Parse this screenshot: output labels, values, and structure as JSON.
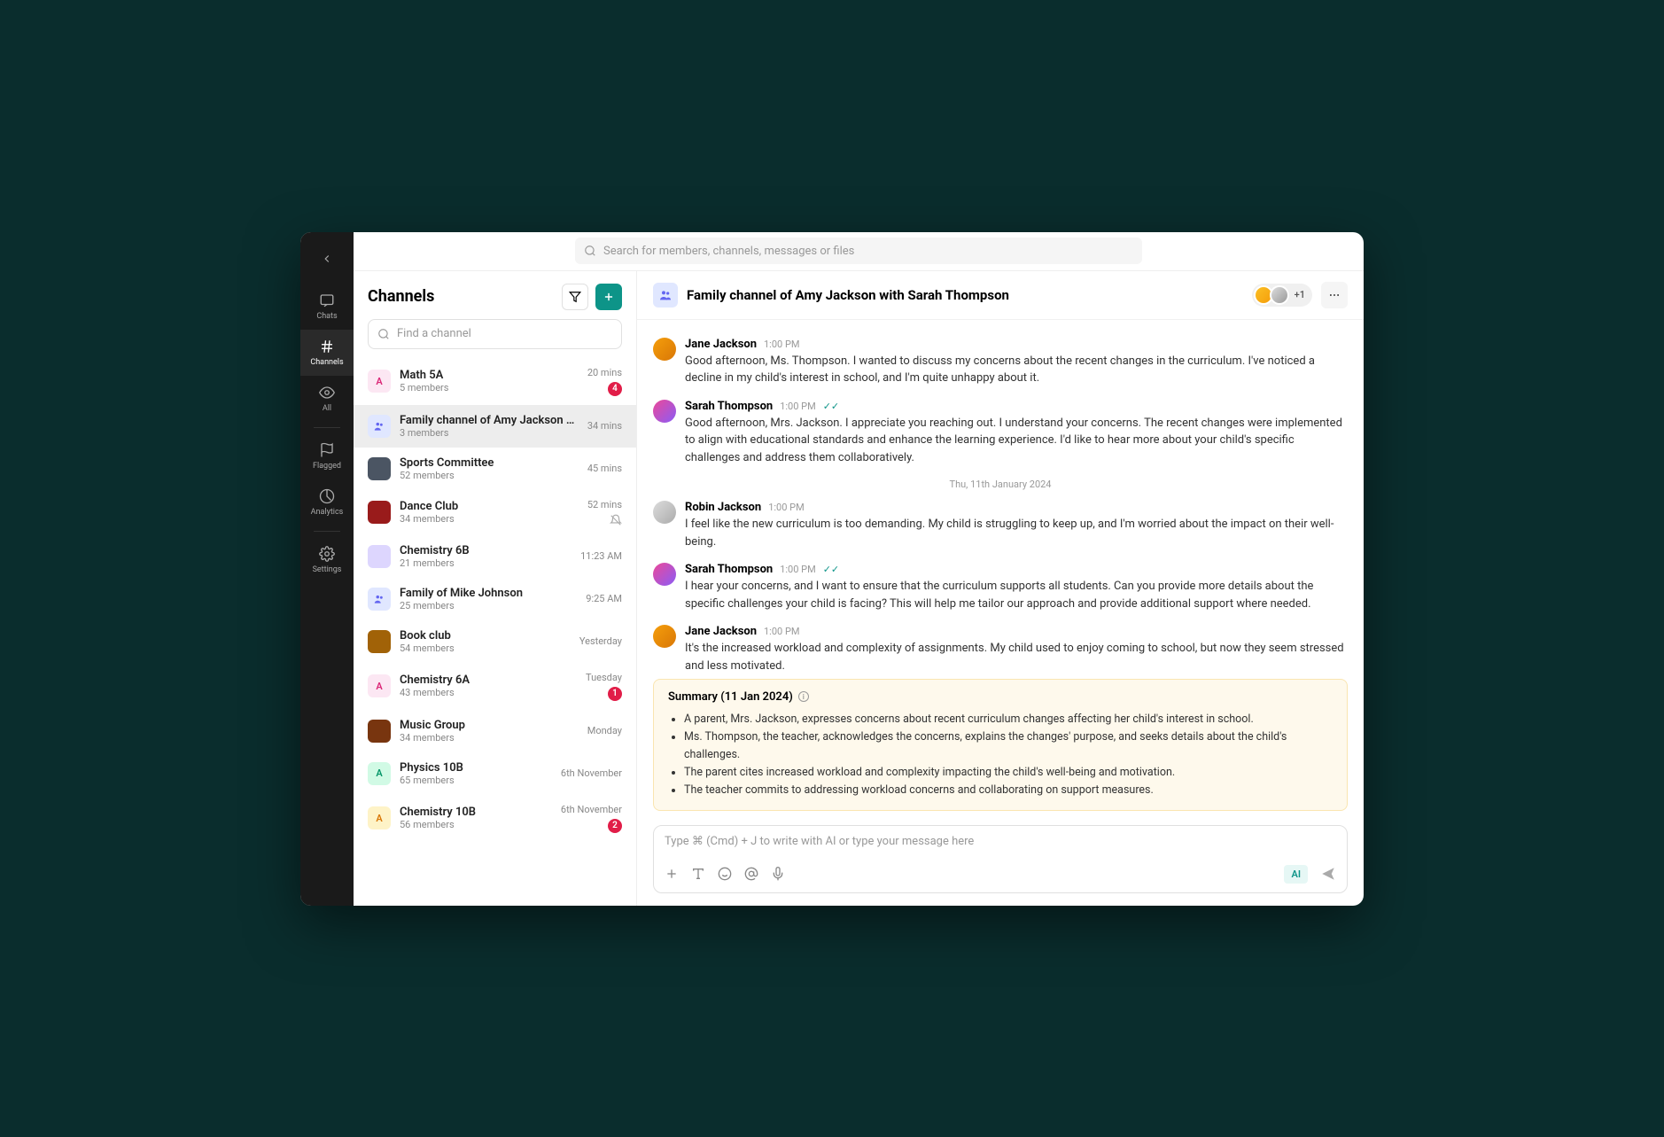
{
  "search": {
    "placeholder": "Search for members, channels, messages or files"
  },
  "nav": {
    "chats": "Chats",
    "channels": "Channels",
    "all": "All",
    "flagged": "Flagged",
    "analytics": "Analytics",
    "settings": "Settings"
  },
  "sidebar": {
    "title": "Channels",
    "search_placeholder": "Find a channel",
    "items": [
      {
        "letter": "A",
        "color": "#fce7f3",
        "fg": "#db2777",
        "name": "Math 5A",
        "sub": "5 members",
        "time": "20 mins",
        "badge": "4"
      },
      {
        "letter": "",
        "color": "#e0e7ff",
        "fg": "#6366f1",
        "name": "Family channel of Amy Jackson with S...",
        "sub": "3 members",
        "time": "34 mins",
        "badge": "",
        "icon": "people"
      },
      {
        "letter": "",
        "color": "#4b5563",
        "fg": "#fff",
        "name": "Sports Committee",
        "sub": "52 members",
        "time": "45 mins",
        "badge": "",
        "img": true
      },
      {
        "letter": "",
        "color": "#991b1b",
        "fg": "#fff",
        "name": "Dance Club",
        "sub": "34 members",
        "time": "52 mins",
        "badge": "",
        "mute": true,
        "img": true
      },
      {
        "letter": "",
        "color": "#ddd6fe",
        "fg": "#7c3aed",
        "name": "Chemistry 6B",
        "sub": "21 members",
        "time": "11:23 AM",
        "badge": "",
        "img": true
      },
      {
        "letter": "",
        "color": "#e0e7ff",
        "fg": "#6366f1",
        "name": "Family of Mike Johnson",
        "sub": "25 members",
        "time": "9:25 AM",
        "badge": "",
        "icon": "people"
      },
      {
        "letter": "",
        "color": "#a16207",
        "fg": "#fff",
        "name": "Book club",
        "sub": "54 members",
        "time": "Yesterday",
        "badge": "",
        "img": true
      },
      {
        "letter": "A",
        "color": "#fce7f3",
        "fg": "#db2777",
        "name": "Chemistry 6A",
        "sub": "43 members",
        "time": "Tuesday",
        "badge": "1"
      },
      {
        "letter": "",
        "color": "#78350f",
        "fg": "#fff",
        "name": "Music Group",
        "sub": "34 members",
        "time": "Monday",
        "badge": "",
        "img": true
      },
      {
        "letter": "A",
        "color": "#d1fae5",
        "fg": "#059669",
        "name": "Physics 10B",
        "sub": "65 members",
        "time": "6th November",
        "badge": ""
      },
      {
        "letter": "A",
        "color": "#fef3c7",
        "fg": "#d97706",
        "name": "Chemistry 10B",
        "sub": "56 members",
        "time": "6th November",
        "badge": "2"
      }
    ]
  },
  "chat": {
    "title": "Family channel of Amy Jackson with Sarah Thompson",
    "more_count": "+1",
    "date_divider": "Thu, 11th January 2024",
    "messages": [
      {
        "av": "a",
        "name": "Jane Jackson",
        "time": "1:00 PM",
        "check": false,
        "text": "Good afternoon, Ms. Thompson. I wanted to discuss my concerns about the recent changes in the curriculum. I've noticed a decline in my child's interest in school, and I'm quite unhappy about it."
      },
      {
        "av": "b",
        "name": "Sarah Thompson",
        "time": "1:00 PM",
        "check": true,
        "text": "Good afternoon, Mrs. Jackson. I appreciate you reaching out. I understand your concerns. The recent changes were implemented to align with educational standards and enhance the learning experience. I'd like to hear more about your child's specific challenges and address them collaboratively."
      },
      {
        "av": "c",
        "name": "Robin Jackson",
        "time": "1:00 PM",
        "check": false,
        "text": "I feel like the new curriculum is too demanding. My child is struggling to keep up, and I'm worried about the impact on their well-being.",
        "after_divider": true
      },
      {
        "av": "b",
        "name": "Sarah Thompson",
        "time": "1:00 PM",
        "check": true,
        "text": "I hear your concerns, and I want to ensure that the curriculum supports all students. Can you provide more details about the specific challenges your child is facing? This will help me tailor our approach and provide additional support where needed."
      },
      {
        "av": "a",
        "name": "Jane Jackson",
        "time": "1:00 PM",
        "check": false,
        "text": "It's the increased workload and complexity of assignments. My child used to enjoy coming to school, but now they seem stressed and less motivated."
      }
    ],
    "summary": {
      "title": "Summary (11 Jan 2024)",
      "bullets": [
        "A parent, Mrs. Jackson, expresses concerns about recent curriculum changes affecting her child's interest in school.",
        "Ms. Thompson, the teacher, acknowledges the concerns, explains the changes' purpose, and seeks details about the child's challenges.",
        "The parent cites increased workload and complexity impacting the child's well-being and motivation.",
        "The teacher commits to addressing workload concerns and collaborating on support measures."
      ]
    },
    "composer": {
      "placeholder": "Type ⌘ (Cmd) + J to write with AI or type your message here",
      "ai_label": "AI"
    }
  }
}
